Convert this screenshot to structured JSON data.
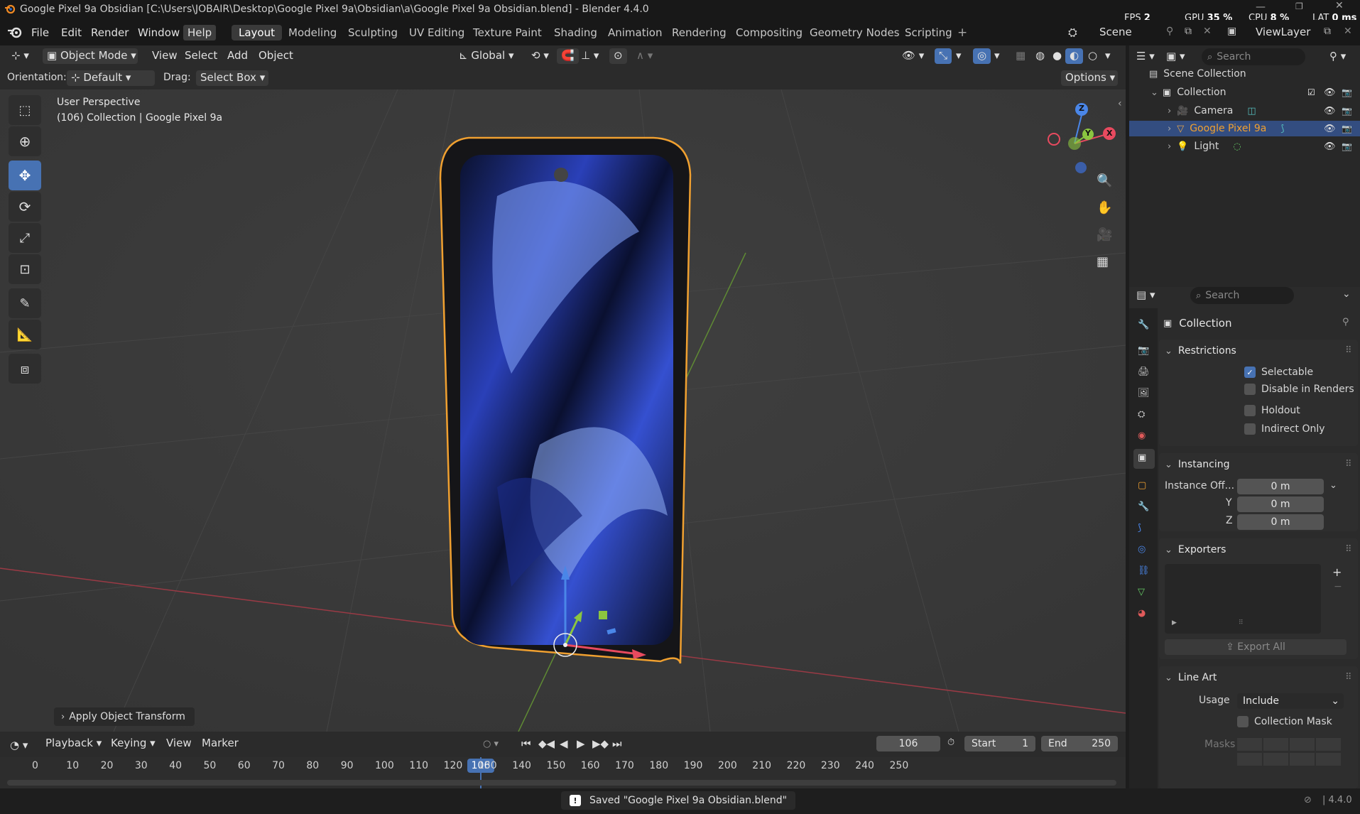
{
  "window": {
    "title": "Google Pixel 9a Obsidian [C:\\Users\\JOBAIR\\Desktop\\Google Pixel 9a\\Obsidian\\a\\Google Pixel 9a Obsidian.blend] - Blender 4.4.0",
    "stats": {
      "fps_label": "FPS",
      "fps": "2",
      "gpu_label": "GPU",
      "gpu": "35 %",
      "cpu_label": "CPU",
      "cpu": "8 %",
      "lat_label": "LAT",
      "lat": "0 ms"
    }
  },
  "menu": [
    "File",
    "Edit",
    "Render",
    "Window",
    "Help"
  ],
  "workspaces": [
    "Layout",
    "Modeling",
    "Sculpting",
    "UV Editing",
    "Texture Paint",
    "Shading",
    "Animation",
    "Rendering",
    "Compositing",
    "Geometry Nodes",
    "Scripting"
  ],
  "scene": {
    "scene_name": "Scene",
    "view_layer": "ViewLayer"
  },
  "viewport_header": {
    "mode": "Object Mode",
    "menus": [
      "View",
      "Select",
      "Add",
      "Object"
    ],
    "transform_orientation": "Global",
    "orientation_label": "Orientation:",
    "orientation_value": "Default",
    "drag_label": "Drag:",
    "drag_value": "Select Box",
    "options": "Options"
  },
  "viewport": {
    "perspective": "User Perspective",
    "collection_info": "(106) Collection | Google Pixel 9a",
    "gizmo_axes": {
      "x": "X",
      "y": "Y",
      "z": "Z"
    },
    "operator_panel": "Apply Object Transform"
  },
  "outliner": {
    "search_placeholder": "Search",
    "root": "Scene Collection",
    "collection": "Collection",
    "items": [
      {
        "name": "Camera",
        "selected": false
      },
      {
        "name": "Google Pixel 9a",
        "selected": true
      },
      {
        "name": "Light",
        "selected": false
      }
    ]
  },
  "properties": {
    "search_placeholder": "Search",
    "context": "Collection",
    "restrictions": {
      "title": "Restrictions",
      "selectable": "Selectable",
      "disable_in_renders": "Disable in Renders",
      "holdout": "Holdout",
      "indirect_only": "Indirect Only",
      "selectable_checked": true
    },
    "instancing": {
      "title": "Instancing",
      "offset_label": "Instance Off...",
      "x": "0 m",
      "y_label": "Y",
      "y": "0 m",
      "z_label": "Z",
      "z": "0 m"
    },
    "exporters": {
      "title": "Exporters",
      "export_all": "Export All"
    },
    "line_art": {
      "title": "Line Art",
      "usage_label": "Usage",
      "usage_value": "Include",
      "collection_mask": "Collection Mask",
      "masks_label": "Masks"
    }
  },
  "timeline": {
    "menus": [
      "Playback",
      "Keying",
      "View",
      "Marker"
    ],
    "current_frame": "106",
    "start_label": "Start",
    "start": "1",
    "end_label": "End",
    "end": "250",
    "ruler": [
      "0",
      "10",
      "20",
      "30",
      "40",
      "50",
      "60",
      "70",
      "80",
      "90",
      "100",
      "110",
      "120",
      "130",
      "140",
      "150",
      "160",
      "170",
      "180",
      "190",
      "200",
      "210",
      "220",
      "230",
      "240",
      "250"
    ]
  },
  "status": {
    "message": "Saved \"Google Pixel 9a Obsidian.blend\"",
    "version": "4.4.0"
  },
  "colors": {
    "accent": "#4772b3",
    "selection_orange": "#f0a030",
    "x_axis": "#e84a5f",
    "y_axis": "#8bc540",
    "z_axis": "#4a86e8"
  }
}
